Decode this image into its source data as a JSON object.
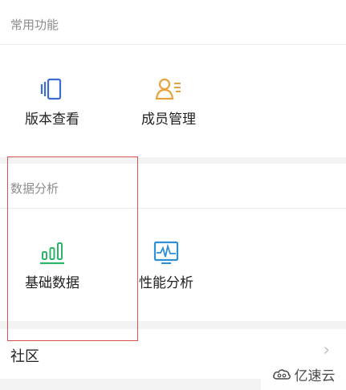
{
  "common": {
    "title": "常用功能",
    "items": [
      {
        "label": "版本查看",
        "icon": "versions-icon"
      },
      {
        "label": "成员管理",
        "icon": "member-manage-icon"
      }
    ]
  },
  "data_analysis": {
    "title": "数据分析",
    "items": [
      {
        "label": "基础数据",
        "icon": "bar-chart-icon"
      },
      {
        "label": "性能分析",
        "icon": "performance-monitor-icon"
      }
    ]
  },
  "community": {
    "label": "社区"
  },
  "watermark": {
    "text": "亿速云"
  },
  "colors": {
    "accent_blue": "#3f6bd6",
    "accent_orange": "#e8a23d",
    "accent_green": "#2db46a",
    "accent_teal": "#2d8fd6",
    "highlight": "#d9534f"
  }
}
